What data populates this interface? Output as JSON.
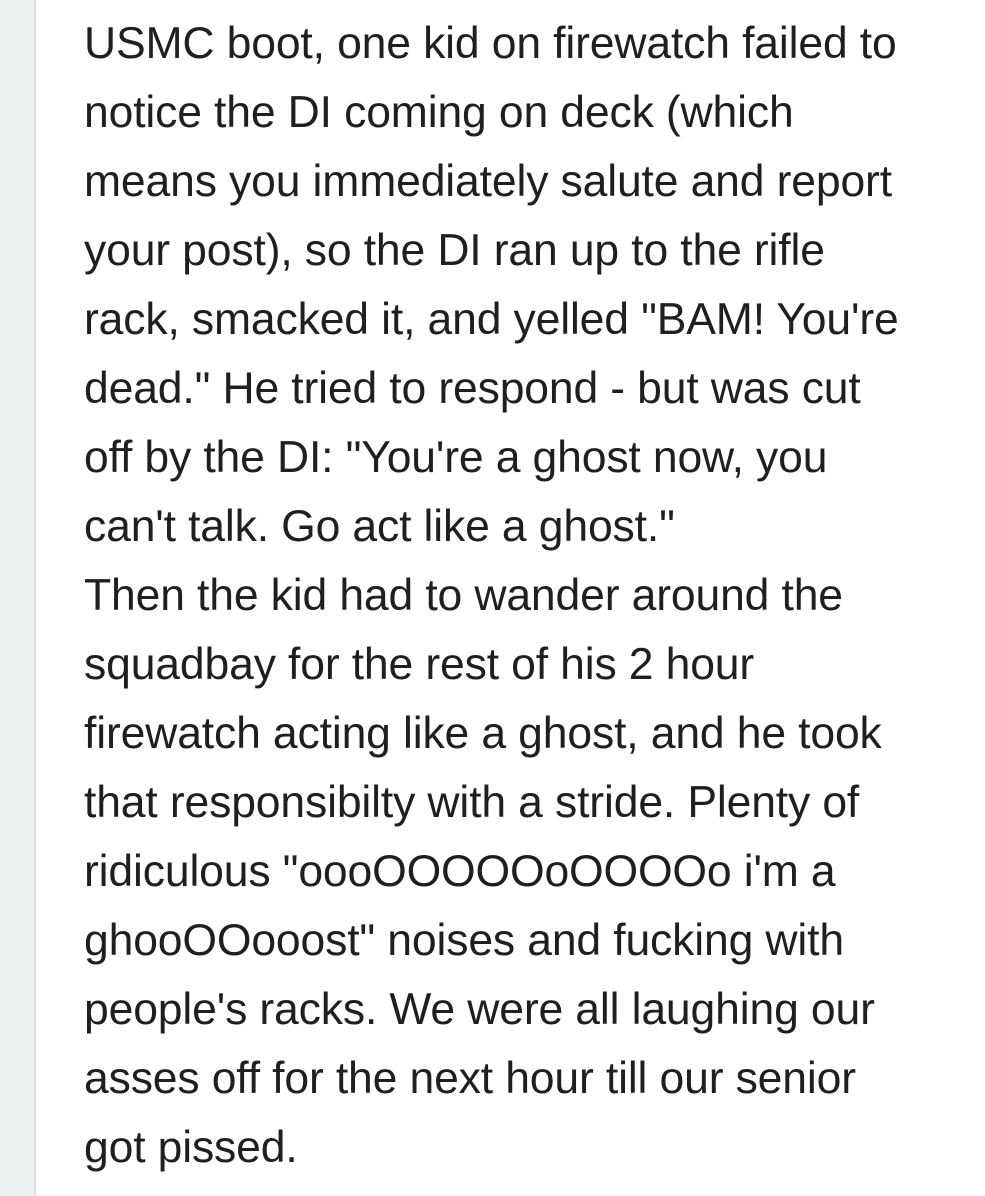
{
  "comment": {
    "paragraphs": [
      {
        "lines": [
          "USMC boot, one kid on firewatch failed to",
          "notice the DI coming on deck (which",
          "means you immediately salute and report",
          "your post), so the DI ran up to the rifle",
          "rack, smacked it, and yelled \"BAM! You're",
          "dead.\" He tried to respond - but was cut",
          "off by the DI: \"You're a ghost now, you",
          "can't talk. Go act like a ghost.\""
        ]
      },
      {
        "lines": [
          "Then the kid had to wander around the",
          "squadbay for the rest of his 2 hour",
          "firewatch acting like a ghost, and he took",
          "that responsibilty with a stride. Plenty of",
          "ridiculous \"oooOOOOOoOOOOo i'm a",
          "ghooOOooost\" noises and fucking with",
          "people's racks. We were all laughing our",
          "asses off for the next hour till our senior",
          "got pissed."
        ]
      }
    ]
  }
}
